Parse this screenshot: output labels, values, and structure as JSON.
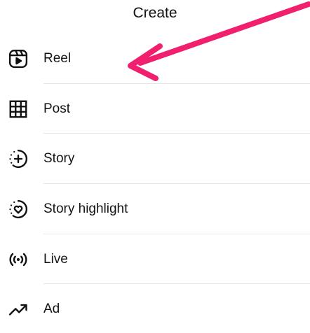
{
  "sheet": {
    "title": "Create"
  },
  "menu": {
    "items": [
      {
        "label": "Reel",
        "icon": "reel-icon"
      },
      {
        "label": "Post",
        "icon": "grid-icon"
      },
      {
        "label": "Story",
        "icon": "story-add-icon"
      },
      {
        "label": "Story highlight",
        "icon": "highlight-heart-icon"
      },
      {
        "label": "Live",
        "icon": "live-broadcast-icon"
      },
      {
        "label": "Ad",
        "icon": "trending-arrow-icon"
      }
    ]
  },
  "annotation": {
    "arrow_color": "#f0206e",
    "points_to": "Reel"
  }
}
